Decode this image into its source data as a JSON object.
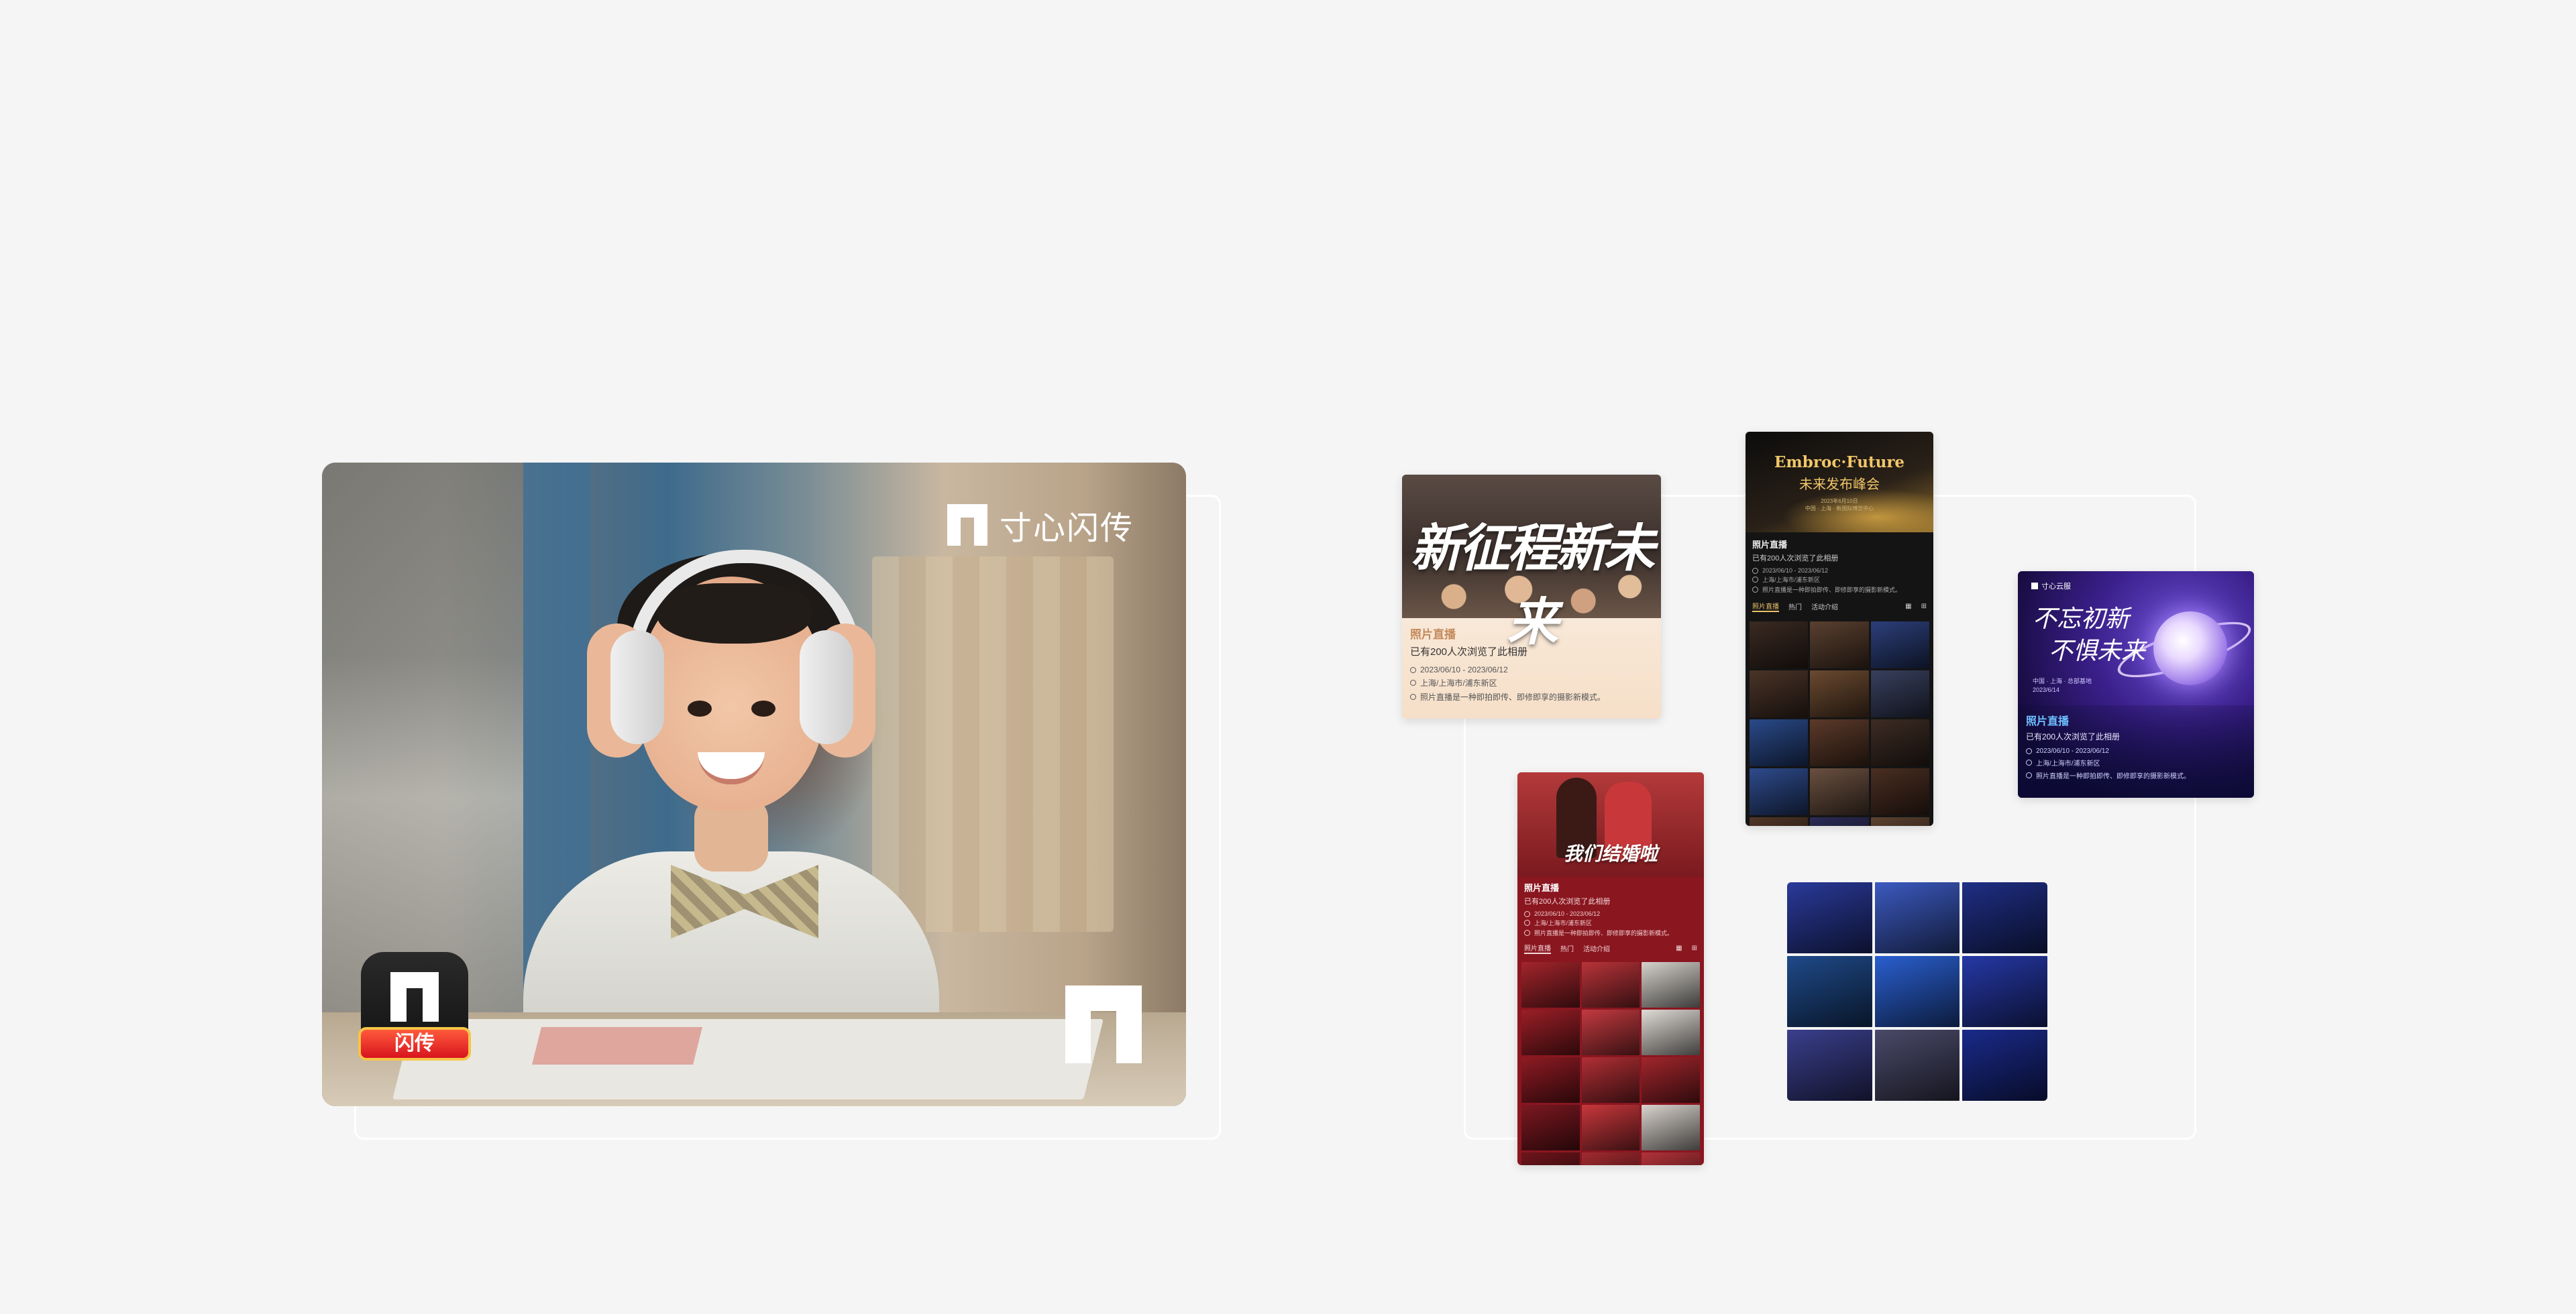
{
  "hero": {
    "brand_name": "寸心闪传",
    "app_badge_label": "闪传"
  },
  "cards": {
    "card_a": {
      "banner_title": "新征程新未来",
      "live_label": "照片直播",
      "views": "已有200人次浏览了此相册",
      "date": "2023/06/10 - 2023/06/12",
      "location": "上海/上海市/浦东新区",
      "description": "照片直播是一种即拍即传、即修即享的摄影新模式。"
    },
    "card_b": {
      "banner_title_en": "Embroc·Future",
      "banner_title_cn": "未来发布峰会",
      "banner_date": "2023年6月10日",
      "banner_place": "中国 · 上海 · 新国际博览中心",
      "live_label": "照片直播",
      "views": "已有200人次浏览了此相册",
      "date": "2023/06/10 - 2023/06/12",
      "location": "上海/上海市/浦东新区",
      "description": "照片直播是一种即拍即传、即修即享的摄影新模式。",
      "tabs": [
        "照片直播",
        "热门",
        "活动介绍"
      ]
    },
    "card_c": {
      "brand": "寸心云服",
      "slogan_line1": "不忘初新",
      "slogan_line2": "不惧未来",
      "sub_place": "中国 · 上海 · 总部基地",
      "sub_date": "2023/6/14",
      "live_label": "照片直播",
      "views": "已有200人次浏览了此相册",
      "date": "2023/06/10 - 2023/06/12",
      "location": "上海/上海市/浦东新区",
      "description": "照片直播是一种即拍即传、即修即享的摄影新模式。"
    },
    "card_d": {
      "banner_title": "我们结婚啦",
      "live_label": "照片直播",
      "views": "已有200人次浏览了此相册",
      "date": "2023/06/10 - 2023/06/12",
      "location": "上海/上海市/浦东新区",
      "description": "照片直播是一种即拍即传、即修即享的摄影新模式。",
      "tabs": [
        "照片直播",
        "热门",
        "活动介绍"
      ]
    }
  },
  "thumb_colors": {
    "card_b": [
      "#3a2a22",
      "#5a4030",
      "#2c3f7a",
      "#4a3428",
      "#6b4a30",
      "#38405e",
      "#2a4a8a",
      "#5c3a2a",
      "#3d2c24",
      "#2e4b8c",
      "#6a5040",
      "#4a2e22",
      "#503628",
      "#2b2b55",
      "#5c4230",
      "#3a2a1e",
      "#704c34",
      "#46302a"
    ],
    "card_d": [
      "#a3252c",
      "#b8343a",
      "#d6d2cc",
      "#9b1f27",
      "#c23a40",
      "#e0dbd5",
      "#8e1b23",
      "#b02f35",
      "#a1262c",
      "#7c1820",
      "#c8373c",
      "#d9d3cd",
      "#6e151b",
      "#a12a30",
      "#b1333a",
      "#5e1217",
      "#8a1c22",
      "#992026"
    ],
    "card_e": [
      "#2a3a9a",
      "#3c5ac0",
      "#1f2f85",
      "#1f4a8a",
      "#2a5fd0",
      "#2638a6",
      "#3a3f8c",
      "#4a4a6a",
      "#1a2a8a"
    ]
  }
}
